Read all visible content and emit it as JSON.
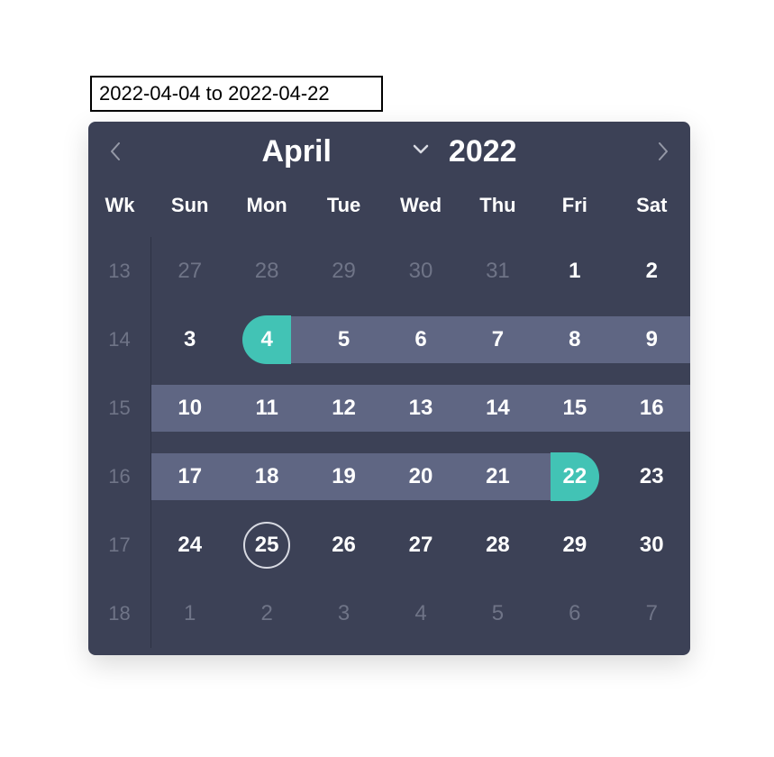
{
  "colors": {
    "panel": "#3c4156",
    "range_bar": "#5f6683",
    "accent": "#42c3b5",
    "muted_text": "#6f7487"
  },
  "input": {
    "value": "2022-04-04 to 2022-04-22"
  },
  "header": {
    "month": "April",
    "year": "2022"
  },
  "columns": {
    "wk": "Wk",
    "days": [
      "Sun",
      "Mon",
      "Tue",
      "Wed",
      "Thu",
      "Fri",
      "Sat"
    ]
  },
  "selection": {
    "start": "2022-04-04",
    "end": "2022-04-22",
    "today": "2022-04-25"
  },
  "weeks": [
    {
      "wk": "13",
      "days": [
        {
          "n": "27",
          "other": true
        },
        {
          "n": "28",
          "other": true
        },
        {
          "n": "29",
          "other": true
        },
        {
          "n": "30",
          "other": true
        },
        {
          "n": "31",
          "other": true
        },
        {
          "n": "1"
        },
        {
          "n": "2"
        }
      ]
    },
    {
      "wk": "14",
      "days": [
        {
          "n": "3"
        },
        {
          "n": "4",
          "start": true
        },
        {
          "n": "5",
          "in": true
        },
        {
          "n": "6",
          "in": true
        },
        {
          "n": "7",
          "in": true
        },
        {
          "n": "8",
          "in": true
        },
        {
          "n": "9",
          "in": true
        }
      ]
    },
    {
      "wk": "15",
      "days": [
        {
          "n": "10",
          "in": true
        },
        {
          "n": "11",
          "in": true
        },
        {
          "n": "12",
          "in": true
        },
        {
          "n": "13",
          "in": true
        },
        {
          "n": "14",
          "in": true
        },
        {
          "n": "15",
          "in": true
        },
        {
          "n": "16",
          "in": true
        }
      ]
    },
    {
      "wk": "16",
      "days": [
        {
          "n": "17",
          "in": true
        },
        {
          "n": "18",
          "in": true
        },
        {
          "n": "19",
          "in": true
        },
        {
          "n": "20",
          "in": true
        },
        {
          "n": "21",
          "in": true
        },
        {
          "n": "22",
          "end": true
        },
        {
          "n": "23"
        }
      ]
    },
    {
      "wk": "17",
      "days": [
        {
          "n": "24"
        },
        {
          "n": "25",
          "today": true
        },
        {
          "n": "26"
        },
        {
          "n": "27"
        },
        {
          "n": "28"
        },
        {
          "n": "29"
        },
        {
          "n": "30"
        }
      ]
    },
    {
      "wk": "18",
      "days": [
        {
          "n": "1",
          "other": true
        },
        {
          "n": "2",
          "other": true
        },
        {
          "n": "3",
          "other": true
        },
        {
          "n": "4",
          "other": true
        },
        {
          "n": "5",
          "other": true
        },
        {
          "n": "6",
          "other": true
        },
        {
          "n": "7",
          "other": true
        }
      ]
    }
  ]
}
